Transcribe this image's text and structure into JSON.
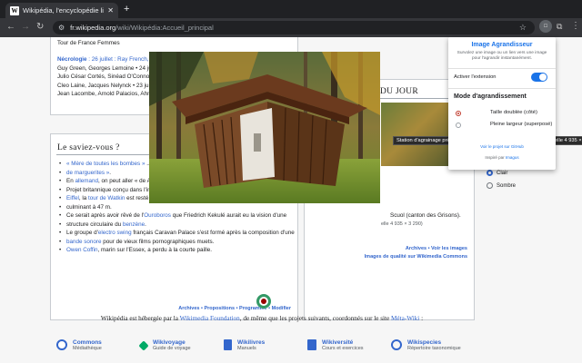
{
  "browser": {
    "tab_title": "Wikipédia, l'encyclopédie libre",
    "tab_favicon": "W",
    "url_domain": "fr.wikipedia.org",
    "url_path": "/wiki/Wikipédia:Accueil_principal",
    "ext_badge": "□"
  },
  "left_box": {
    "top_link": "Tour de France Femmes",
    "necro_label": "Nécrologie",
    "necro_text": " : 26 juillet : Ray French, ",
    "necro_lines": [
      "Guy Green, Georges Lemoine • 24 ju",
      "Julio César Cortés, Sinéad O'Connor • 22",
      "Cleo Laine, Jacques Nelynck • 23 juil",
      "Jean Lacombe, Arnold Palacios, Ahm"
    ]
  },
  "saviez": {
    "heading": "Le saviez-vous ?",
    "facts": [
      {
        "pre": "",
        "link": "« Mère de toutes les bombes »",
        "post": " ..."
      },
      {
        "pre": "",
        "link": "de marguerites »",
        "post": "."
      },
      {
        "pre": "En ",
        "link": "allemand",
        "post": ", on peut aller « de A"
      },
      {
        "pre": "Projet britannique conçu dans l'int",
        "link": "",
        "post": ""
      },
      {
        "pre": "",
        "link": "Eiffel",
        "post": ", la "
      },
      {
        "pre": "culminant à 47 m.",
        "link": "",
        "post": ""
      },
      {
        "pre": "Ce serait après avoir rêvé de l'",
        "link": "Ouroboros",
        "post": " que Friedrich Kekulé aurait eu la vision d'une"
      },
      {
        "pre": "structure circulaire du ",
        "link": "benzène",
        "post": "."
      },
      {
        "pre": "Le groupe d'",
        "link": "electro swing",
        "post": " français Caravan Palace s'est formé après la composition d'une"
      },
      {
        "pre": "",
        "link": "bande sonore",
        "post": " pour de vieux films pornographiques muets."
      },
      {
        "pre": "",
        "link": "Owen Coffin",
        "post": ", marin sur l'Essex, a perdu à la courte paille."
      }
    ],
    "footer": "Archives • Propositions • Programme • Modifier",
    "tour_watkin": "tour de Watkin",
    "reste": " est resté"
  },
  "image_du_jour": {
    "heading": "DU JOUR",
    "caption_link": "Scuol (canton des Grisons).",
    "caption_dim": "elle 4 935 × 3 290)",
    "archives": "Archives • Voir les images",
    "qualite": "Images de qualité sur Wikimedia Commons",
    "theme_clair": "Clair",
    "theme_sombre": "Sombre"
  },
  "tooltip": "Station d'agrainage près de Scuol (canton des Grisons). (définition réelle 4 935 × 3",
  "footer_text_pre": "Wikipédia est hébergée par la ",
  "footer_link": "Wikimedia Foundation",
  "footer_text_post": ", de même que les projets suivants, coordonnés sur le site ",
  "footer_meta": "Méta-Wiki",
  "footer_end": " :",
  "sisters": [
    {
      "name": "Commons",
      "desc": "Médiathèque",
      "color": "#36c"
    },
    {
      "name": "Wikivoyage",
      "desc": "Guide de voyage",
      "color": "#0a6"
    },
    {
      "name": "Wikilivres",
      "desc": "Manuels",
      "color": "#36c"
    },
    {
      "name": "Wikiversité",
      "desc": "Cours et exercices",
      "color": "#36c"
    },
    {
      "name": "Wikispecies",
      "desc": "Répertoire taxonomique",
      "color": "#36c"
    }
  ],
  "popup": {
    "title": "Image Agrandisseur",
    "desc": "Survolez une image ou un lien vers une image pour l'agrandir instantanément.",
    "activate": "Activer l'extension",
    "section": "Mode d'agrandissement",
    "opt1": "Taille doublée (côté)",
    "opt2": "Pleine largeur (superposé)",
    "github": "Voir le projet sur GitHub",
    "inspired_pre": "Inspiré par ",
    "inspired_link": "Imagus"
  }
}
